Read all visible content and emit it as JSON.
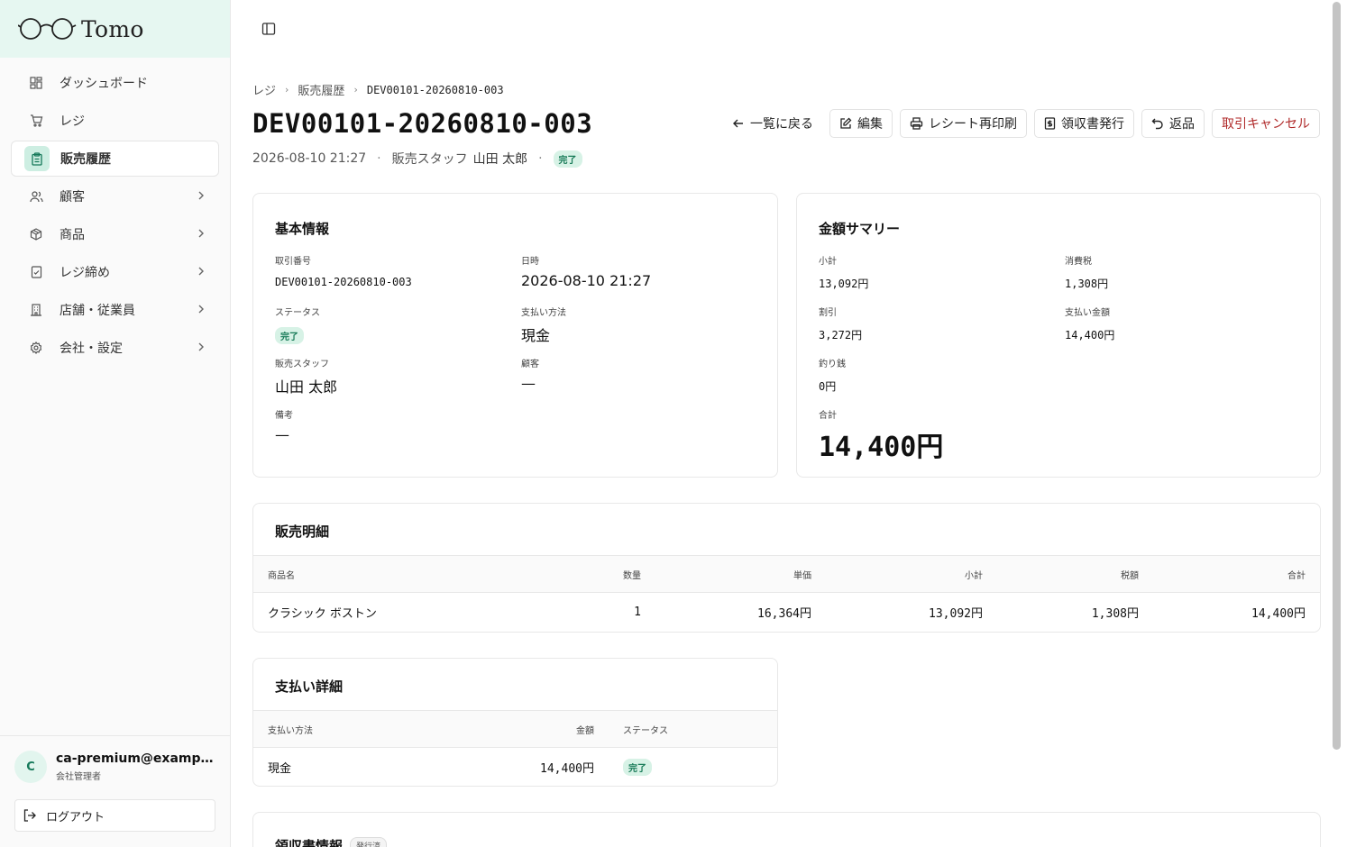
{
  "app": {
    "logo_text": "Tomo"
  },
  "sidebar": {
    "items": [
      {
        "label": "ダッシュボード",
        "icon": "dashboard-icon"
      },
      {
        "label": "レジ",
        "icon": "cart-icon"
      },
      {
        "label": "販売履歴",
        "icon": "clipboard-icon",
        "active": true
      },
      {
        "label": "顧客",
        "icon": "users-icon"
      },
      {
        "label": "商品",
        "icon": "package-icon"
      },
      {
        "label": "レジ締め",
        "icon": "checklist-icon"
      },
      {
        "label": "店舗・従業員",
        "icon": "building-icon"
      },
      {
        "label": "会社・設定",
        "icon": "gear-icon"
      }
    ],
    "user": {
      "initial": "C",
      "email": "ca-premium@example.com",
      "role": "会社管理者"
    },
    "logout_label": "ログアウト"
  },
  "breadcrumb": {
    "items": [
      "レジ",
      "販売履歴"
    ],
    "current": "DEV00101-20260810-003"
  },
  "page": {
    "title": "DEV00101-20260810-003",
    "datetime": "2026-08-10 21:27",
    "staff_label": "販売スタッフ",
    "staff_name": "山田 太郎",
    "status": "完了"
  },
  "actions": {
    "back": "一覧に戻る",
    "edit": "編集",
    "reprint": "レシート再印刷",
    "receipt": "領収書発行",
    "refund": "返品",
    "cancel": "取引キャンセル"
  },
  "basic_info": {
    "title": "基本情報",
    "txn_no_label": "取引番号",
    "txn_no": "DEV00101-20260810-003",
    "datetime_label": "日時",
    "datetime": "2026-08-10 21:27",
    "status_label": "ステータス",
    "status": "完了",
    "payment_label": "支払い方法",
    "payment": "現金",
    "staff_label": "販売スタッフ",
    "staff": "山田 太郎",
    "customer_label": "顧客",
    "customer": "—",
    "note_label": "備考",
    "note": "—"
  },
  "summary": {
    "title": "金額サマリー",
    "subtotal_label": "小計",
    "subtotal": "13,092円",
    "tax_label": "消費税",
    "tax": "1,308円",
    "discount_label": "割引",
    "discount": "3,272円",
    "paid_label": "支払い金額",
    "paid": "14,400円",
    "change_label": "釣り銭",
    "change": "0円",
    "total_label": "合計",
    "total": "14,400円"
  },
  "sales_detail": {
    "title": "販売明細",
    "headers": [
      "商品名",
      "数量",
      "単価",
      "小計",
      "税額",
      "合計"
    ],
    "rows": [
      [
        "クラシック ボストン",
        "1",
        "16,364円",
        "13,092円",
        "1,308円",
        "14,400円"
      ]
    ]
  },
  "payment_detail": {
    "title": "支払い詳細",
    "headers": [
      "支払い方法",
      "金額",
      "ステータス"
    ],
    "rows": [
      [
        "現金",
        "14,400円",
        "完了"
      ]
    ]
  },
  "receipt_info": {
    "title": "領収書情報",
    "badge": "発行済"
  },
  "colors": {
    "accent": "#16795a",
    "accent_bg": "#e6f7f1",
    "danger": "#b02a2a"
  }
}
